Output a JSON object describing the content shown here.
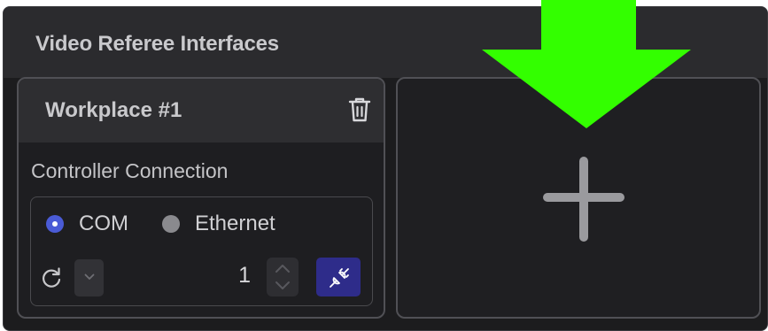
{
  "panel": {
    "title": "Video Referee Interfaces"
  },
  "workplace": {
    "title": "Workplace #1",
    "controller_label": "Controller Connection",
    "connection_options": [
      {
        "label": "COM",
        "selected": true
      },
      {
        "label": "Ethernet",
        "selected": false
      }
    ],
    "port_value": "1"
  },
  "icons": {
    "delete": "trash-icon",
    "refresh": "refresh-icon",
    "dropdown": "chevron-down-icon",
    "connect": "plug-connect-icon",
    "add": "plus-icon",
    "annotation": "arrow-down-icon"
  },
  "colors": {
    "accent": "#4a5bd6",
    "connect_button": "#2e2c8a",
    "annotation_arrow": "#33ff00"
  }
}
